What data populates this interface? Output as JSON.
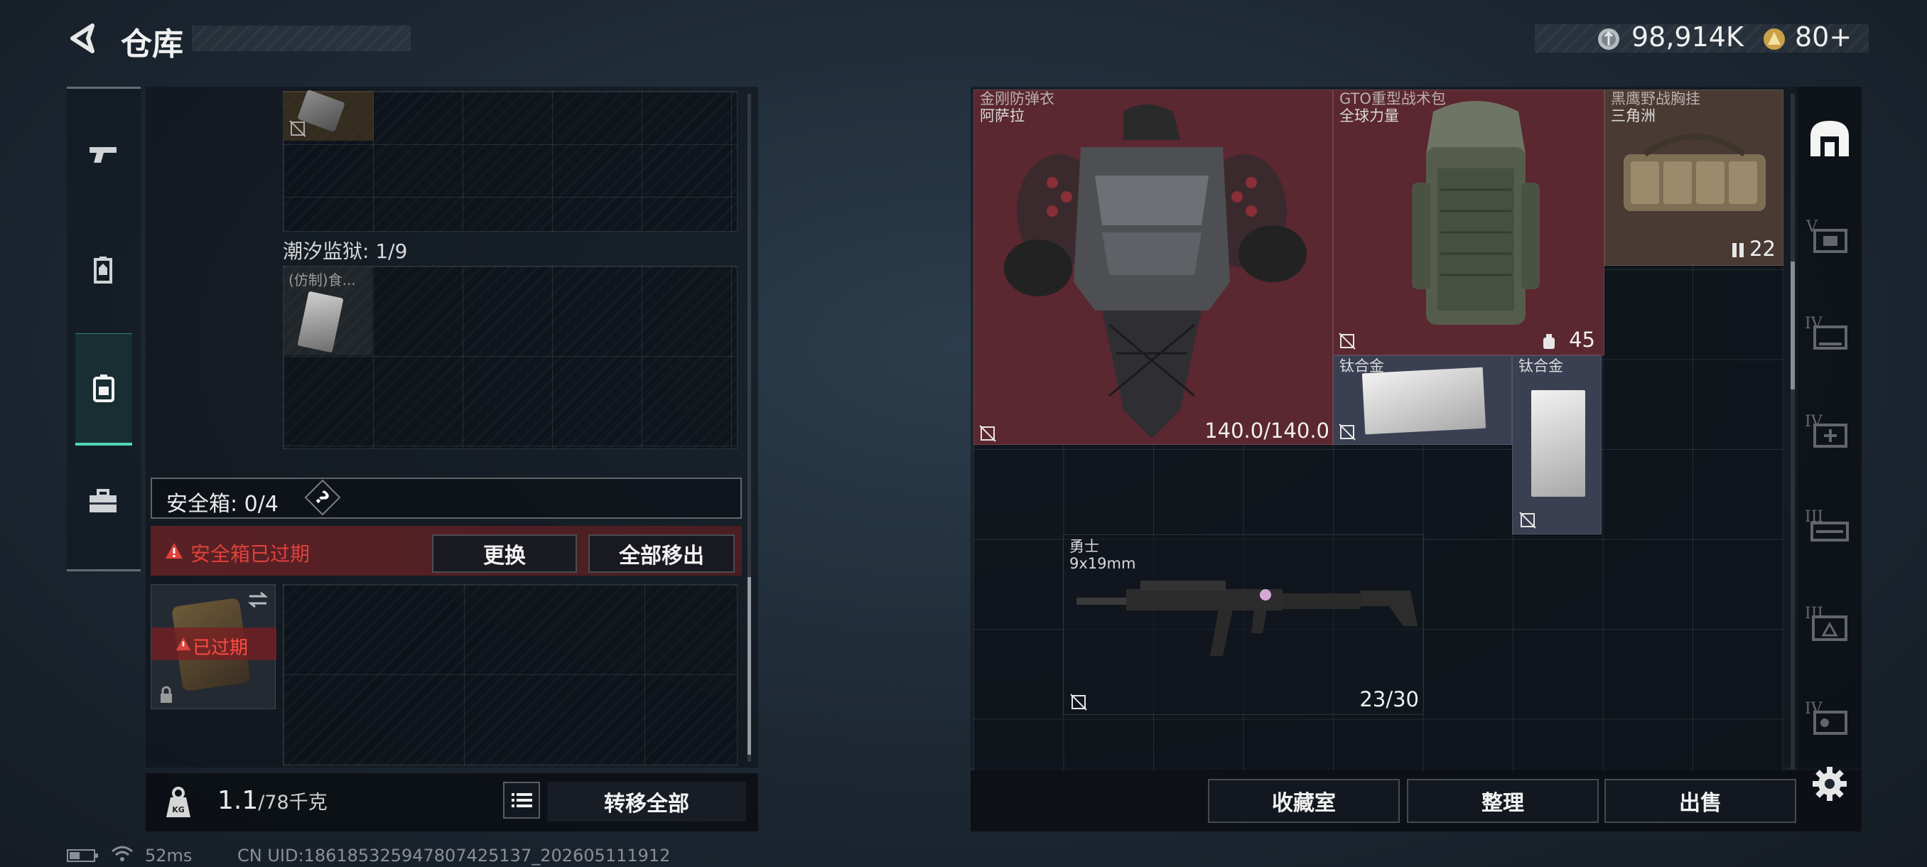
{
  "header": {
    "title": "仓库",
    "currency_amount": "98,914K",
    "ticket_amount": "80+"
  },
  "left_tabs": [
    "weapon",
    "helmet",
    "backpack",
    "toolbox"
  ],
  "left_panel": {
    "container_label": "潮汐监狱: 1/9",
    "item_partial_label": "(仿制)食...",
    "safebox": {
      "label": "安全箱: 0/4",
      "help": "?",
      "expired_warning": "安全箱已过期",
      "replace_button": "更换",
      "move_all_out_button": "全部移出",
      "expired_badge": "已过期"
    },
    "weight": {
      "current": "1.1",
      "capacity": "/78千克"
    },
    "transfer_all_button": "转移全部"
  },
  "storage_items": [
    {
      "name": "金刚防弹衣",
      "brand": "阿萨拉",
      "stat": "140.0/140.0"
    },
    {
      "name": "GTO重型战术包",
      "brand": "全球力量",
      "stat": "45"
    },
    {
      "name": "黑鹰野战胸挂",
      "brand": "三角洲",
      "stat": "22"
    },
    {
      "name": "钛合金",
      "brand": "",
      "stat": ""
    },
    {
      "name": "钛合金",
      "brand": "",
      "stat": ""
    },
    {
      "name": "勇士",
      "brand": "9x19mm",
      "stat": "23/30"
    }
  ],
  "bottom_buttons": {
    "collection": "收藏室",
    "organize": "整理",
    "sell": "出售"
  },
  "right_tabs": [
    "home-base",
    "V",
    "IV",
    "IV",
    "III",
    "III",
    "IV"
  ],
  "status_bar": {
    "ping": "52ms",
    "uid": "CN UID:1861853259478074251​37_202605111912"
  },
  "colors": {
    "armor_bg": "#5b2730",
    "backpack_bg": "#5b2730",
    "vest_bg": "#4a3a34",
    "titanium_bg": "#3a3f52",
    "warning_red": "#e0413c",
    "accent_teal": "#4ed7b0"
  }
}
